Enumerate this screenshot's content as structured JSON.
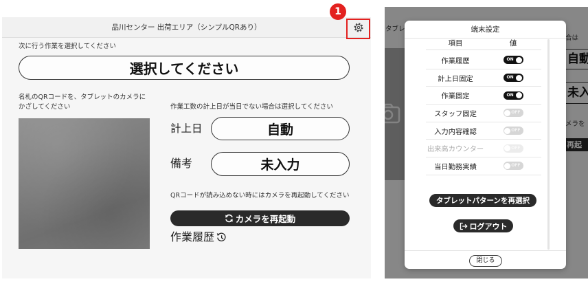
{
  "annotation": {
    "badge": "1"
  },
  "main": {
    "header_title": "品川センター 出荷エリア（シンプルQRあり）",
    "task_prompt": "次に行う作業を選択してください",
    "task_button": "選択してください",
    "qr_instruction_line1": "名札のQRコードを、タブレットのカメラに",
    "qr_instruction_line2": "かざしてください",
    "date_instruction": "作業工数の計上日が当日でない場合は選択してください",
    "date_label": "計上日",
    "date_value": "自動",
    "remarks_label": "備考",
    "remarks_value": "未入力",
    "camera_hint": "QRコードが読み込めない時にはカメラを再起動してください",
    "restart_camera_button": "カメラを再起動",
    "history_link": "作業履歴"
  },
  "background_page": {
    "title_fragment": "タブレ",
    "date_hint_fragment": "合は",
    "date_value_fragment": "自動",
    "remarks_value_fragment": "未入",
    "camera_hint_fragment": "メラを",
    "restart_fragment": "再起"
  },
  "settings_modal": {
    "title": "端末設定",
    "col_item": "項目",
    "col_value": "値",
    "rows": [
      {
        "label": "作業履歴",
        "state": "ON",
        "on": true,
        "disabled": false
      },
      {
        "label": "計上日固定",
        "state": "ON",
        "on": true,
        "disabled": false
      },
      {
        "label": "作業固定",
        "state": "ON",
        "on": true,
        "disabled": false
      },
      {
        "label": "スタッフ固定",
        "state": "OFF",
        "on": false,
        "disabled": false
      },
      {
        "label": "入力内容確認",
        "state": "OFF",
        "on": false,
        "disabled": false
      },
      {
        "label": "出来高カウンター",
        "state": "OFF",
        "on": false,
        "disabled": true
      },
      {
        "label": "当日勤務実績",
        "state": "OFF",
        "on": false,
        "disabled": false
      }
    ],
    "reselect_button": "タブレットパターンを再選択",
    "logout_button": "ログアウト",
    "close_button": "閉じる"
  },
  "icons": {
    "settings": "gear-icon",
    "restart": "refresh-icon",
    "history": "history-icon",
    "logout": "logout-icon",
    "camera": "camera-icon"
  },
  "colors": {
    "dark_button": "#2a2a2a",
    "annotation_red": "#e3211f",
    "toggle_on": "#111111",
    "toggle_off": "#d6d6d6",
    "disabled_text": "#a8a8a8"
  }
}
